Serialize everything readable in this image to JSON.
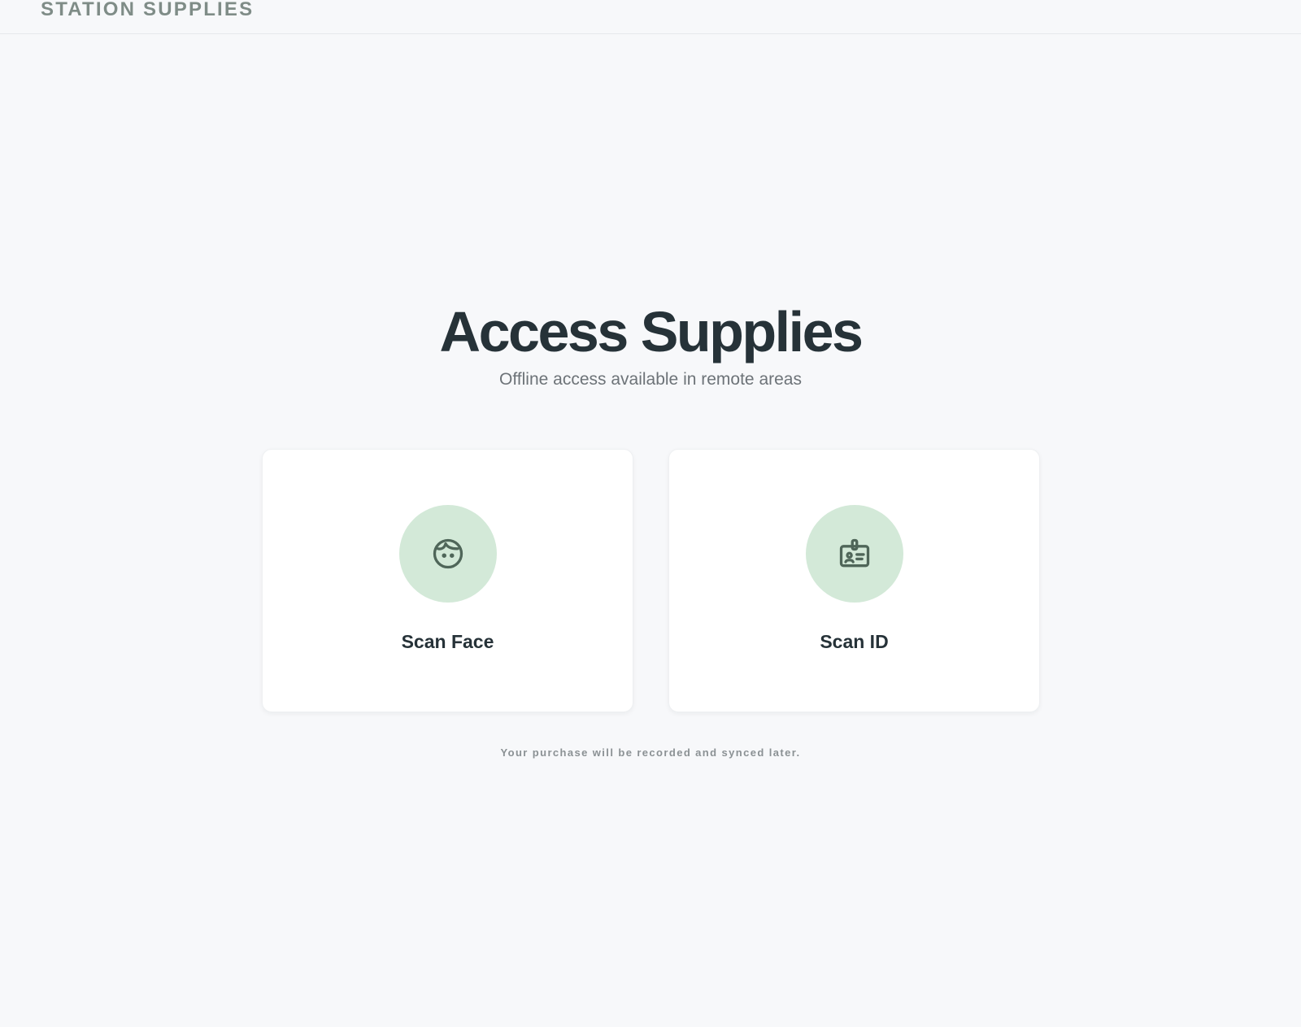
{
  "header": {
    "brand": "STATION SUPPLIES"
  },
  "hero": {
    "title": "Access Supplies",
    "subtitle": "Offline access available in remote areas"
  },
  "options": [
    {
      "label": "Scan Face",
      "icon": "face-icon"
    },
    {
      "label": "Scan ID",
      "icon": "id-badge-icon"
    }
  ],
  "footnote": "Your purchase will be recorded and synced later.",
  "colors": {
    "accent_bg": "#d3e9d8",
    "icon_stroke": "#4f6659",
    "text_dark": "#263238",
    "brand_text": "#7f8c87",
    "page_bg": "#f7f8fa"
  }
}
